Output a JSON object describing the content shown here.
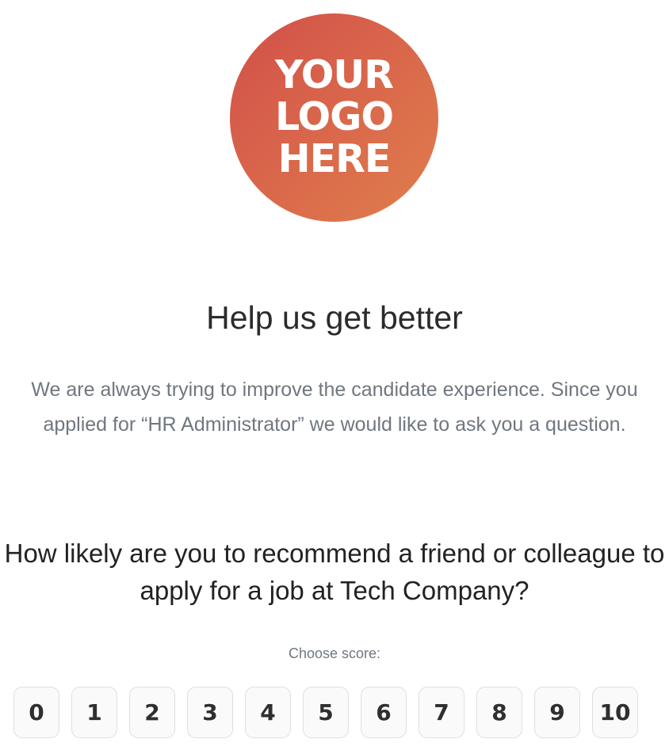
{
  "logo": {
    "text": "YOUR\nLOGO\nHERE",
    "gradient": [
      "#d2504a",
      "#e07e4c"
    ]
  },
  "heading": "Help us get better",
  "intro": "We are always trying to improve the candidate experience. Since you applied for “HR Administrator” we would like to ask you a question.",
  "question": "How likely are you to recommend a friend or colleague to apply for a job at Tech Company?",
  "choose_label": "Choose score:",
  "scores": [
    "0",
    "1",
    "2",
    "3",
    "4",
    "5",
    "6",
    "7",
    "8",
    "9",
    "10"
  ]
}
